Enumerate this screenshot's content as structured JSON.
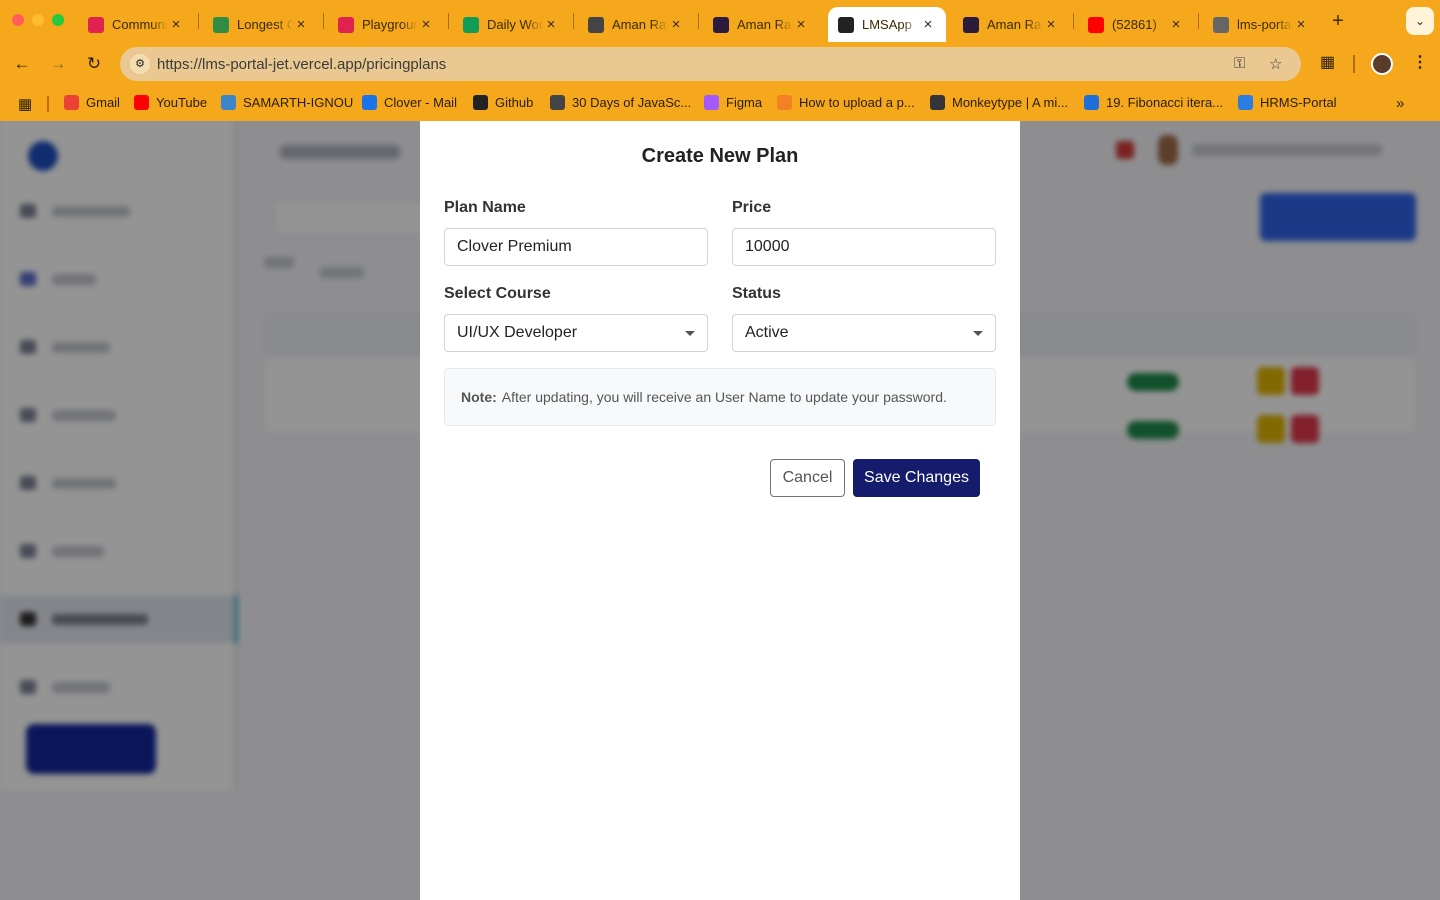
{
  "browser": {
    "tabs": [
      {
        "title": "Community",
        "icon": "angular-icon",
        "color": "#e0234e"
      },
      {
        "title": "Longest Common",
        "icon": "gfg-icon",
        "color": "#2f8d46"
      },
      {
        "title": "Playground",
        "icon": "angular-icon",
        "color": "#e0234e"
      },
      {
        "title": "Daily Work",
        "icon": "sheets-icon",
        "color": "#0f9d58"
      },
      {
        "title": "Aman Raj",
        "icon": "globe-icon",
        "color": "#444444"
      },
      {
        "title": "Aman Raj",
        "icon": "avatar-icon",
        "color": "#2b1b3c"
      },
      {
        "title": "LMSApp",
        "icon": "angular-icon",
        "color": "#222222",
        "active": true
      },
      {
        "title": "Aman Raj",
        "icon": "avatar-icon",
        "color": "#2b1b3c"
      },
      {
        "title": "(52861) ",
        "icon": "youtube-icon",
        "color": "#ff0000"
      },
      {
        "title": "lms-portal",
        "icon": "globe-icon",
        "color": "#666666"
      }
    ],
    "url": "https://lms-portal-jet.vercel.app/pricingplans",
    "bookmarks": [
      {
        "label": "Gmail",
        "icon": "gmail-icon",
        "color": "#ea4335"
      },
      {
        "label": "YouTube",
        "icon": "youtube-icon",
        "color": "#ff0000"
      },
      {
        "label": "SAMARTH-IGNOU",
        "icon": "samarth-icon",
        "color": "#3a86c8"
      },
      {
        "label": "Clover - Mail",
        "icon": "clover-icon",
        "color": "#1a73e8"
      },
      {
        "label": "Github",
        "icon": "github-icon",
        "color": "#222222"
      },
      {
        "label": "30 Days of JavaSc...",
        "icon": "leetcode-icon",
        "color": "#444444"
      },
      {
        "label": "Figma",
        "icon": "figma-icon",
        "color": "#a259ff"
      },
      {
        "label": "How to upload a p...",
        "icon": "stackoverflow-icon",
        "color": "#f48024"
      },
      {
        "label": "Monkeytype | A mi...",
        "icon": "monkeytype-icon",
        "color": "#323437"
      },
      {
        "label": "19. Fibonacci itera...",
        "icon": "codingninja-icon",
        "color": "#1e6fd9"
      },
      {
        "label": "HRMS-Portal",
        "icon": "bolt-icon",
        "color": "#2a7de1"
      }
    ]
  },
  "modal": {
    "title": "Create New Plan",
    "plan_name_label": "Plan Name",
    "plan_name_value": "Clover Premium",
    "price_label": "Price",
    "price_value": "10000",
    "course_label": "Select Course",
    "course_value": "UI/UX Developer",
    "status_label": "Status",
    "status_value": "Active",
    "note_prefix": "Note:",
    "note_text": "After updating, you will receive an User Name to update your password.",
    "cancel_label": "Cancel",
    "save_label": "Save Changes"
  },
  "colors": {
    "browser_chrome": "#f6a81c",
    "save_button": "#141c6b",
    "overlay": "rgba(0,0,0,0.42)"
  }
}
